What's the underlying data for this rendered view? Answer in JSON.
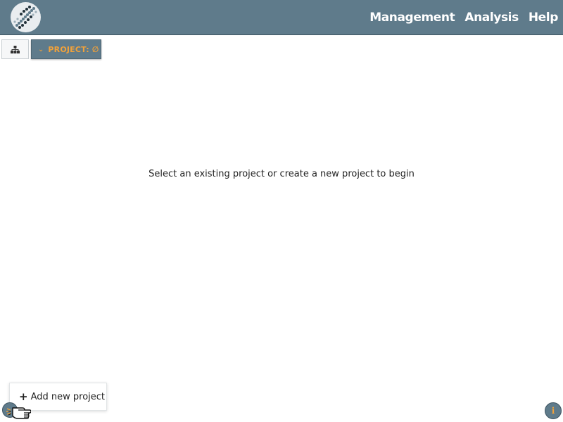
{
  "header": {
    "logo_icon": "dna-helix-logo-icon",
    "nav": [
      {
        "label": "Management"
      },
      {
        "label": "Analysis"
      },
      {
        "label": "Help"
      }
    ]
  },
  "toolbar": {
    "tree_icon": "sitemap-icon",
    "project_button": {
      "chevron_icon": "chevron-down-icon",
      "label": "PROJECT: ∅"
    }
  },
  "main": {
    "message": "Select an existing project or create a new project to begin"
  },
  "footer": {
    "add_project": {
      "icon": "plus-icon",
      "label": "Add new project"
    },
    "info_icon": "info-icon",
    "info_glyph": "i"
  },
  "colors": {
    "header_bg": "#5f7b8b",
    "accent": "#f2a23a"
  }
}
